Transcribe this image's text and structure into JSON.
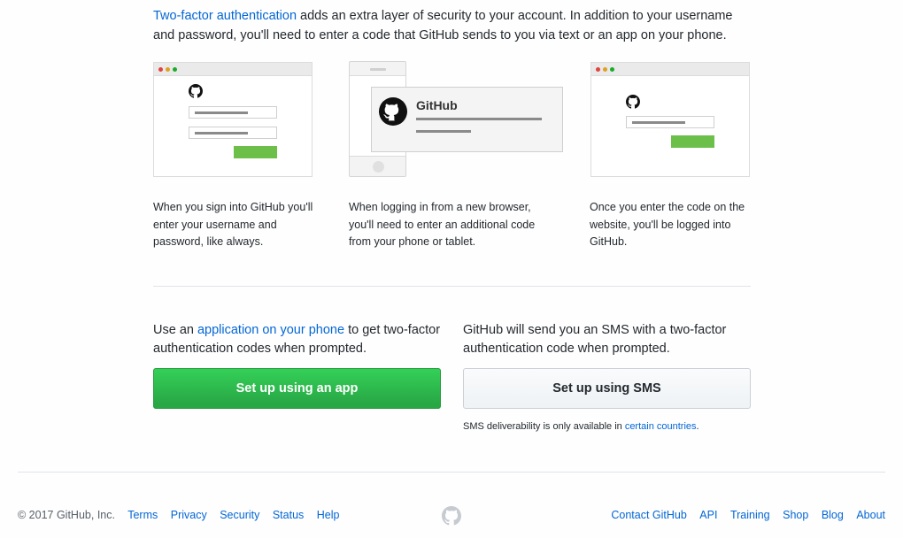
{
  "intro": {
    "link": "Two-factor authentication",
    "text": " adds an extra layer of security to your account. In addition to your username and password, you'll need to enter a code that GitHub sends to you via text or an app on your phone."
  },
  "illustrations": {
    "phone_title": "GitHub"
  },
  "steps": [
    {
      "text": "When you sign into GitHub you'll enter your username and password, like always."
    },
    {
      "text": "When logging in from a new browser, you'll need to enter an additional code from your phone or tablet."
    },
    {
      "text": "Once you enter the code on the website, you'll be logged into GitHub."
    }
  ],
  "app_option": {
    "prefix": "Use an ",
    "link": "application on your phone",
    "suffix": " to get two-factor authentication codes when prompted.",
    "button": "Set up using an app"
  },
  "sms_option": {
    "text": "GitHub will send you an SMS with a two-factor authentication code when prompted.",
    "button": "Set up using SMS",
    "note_prefix": "SMS deliverability is only available in ",
    "note_link": "certain countries",
    "note_suffix": "."
  },
  "footer": {
    "copyright": "© 2017 GitHub, Inc.",
    "left_links": [
      "Terms",
      "Privacy",
      "Security",
      "Status",
      "Help"
    ],
    "right_links": [
      "Contact GitHub",
      "API",
      "Training",
      "Shop",
      "Blog",
      "About"
    ]
  },
  "colors": {
    "link": "#0366d6",
    "primary_button": "#2cbe4e",
    "text": "#24292e"
  },
  "icons": {
    "logo": "github-octocat-icon"
  }
}
